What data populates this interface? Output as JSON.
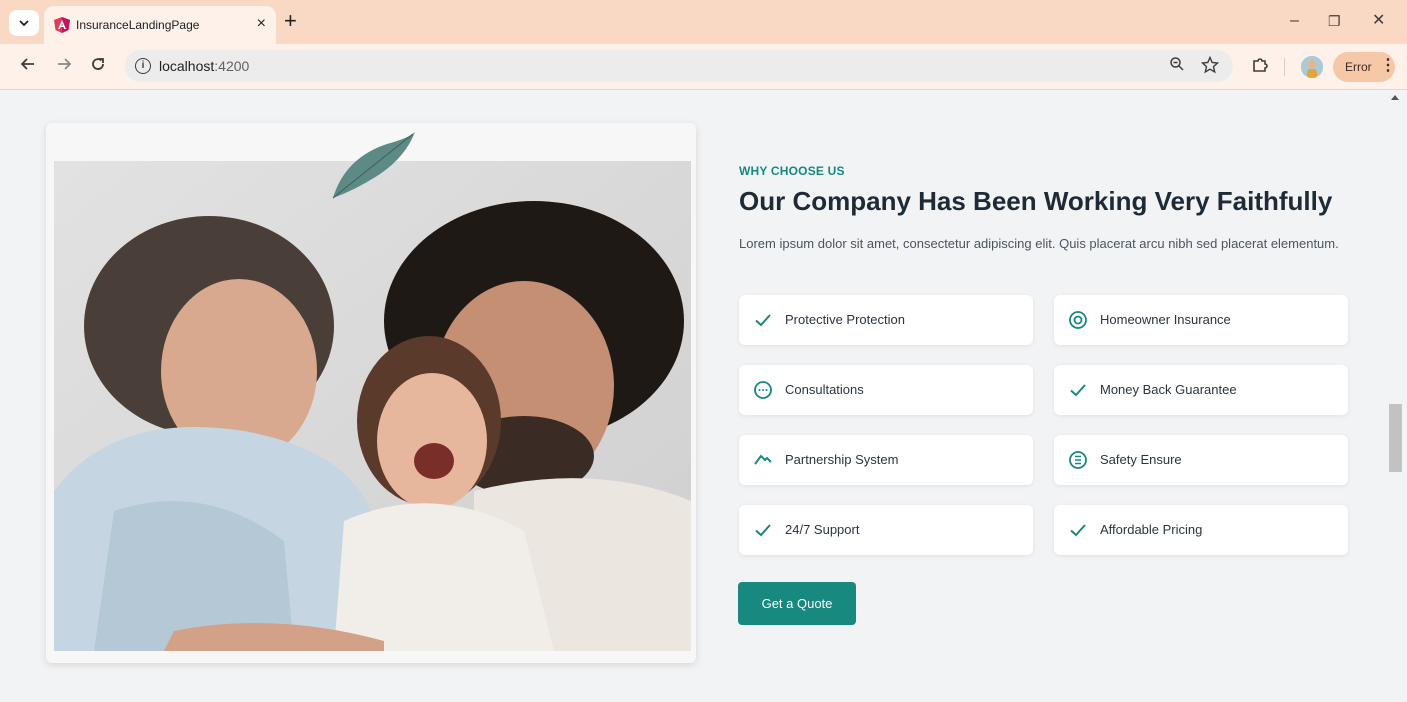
{
  "browser": {
    "tab_title": "InsuranceLandingPage",
    "tab_close": "×",
    "new_tab": "+",
    "window_controls": {
      "minimize": "–",
      "restore": "❐",
      "close": "✕"
    },
    "url_host": "localhost",
    "url_port": ":4200",
    "error_label": "Error",
    "icons": [
      "tab-dropdown-icon",
      "angular-favicon",
      "back-arrow-icon",
      "forward-arrow-icon",
      "reload-icon",
      "site-info-icon",
      "zoom-icon",
      "bookmark-star-icon",
      "extensions-icon",
      "profile-avatar",
      "menu-dots-icon"
    ]
  },
  "section": {
    "eyebrow": "WHY CHOOSE US",
    "heading": "Our Company Has Been Working Very Faithfully",
    "description": "Lorem ipsum dolor sit amet, consectetur adipiscing elit. Quis placerat arcu nibh sed placerat elementum.",
    "features": [
      {
        "label": "Protective Protection",
        "icon": "check-icon"
      },
      {
        "label": "Homeowner Insurance",
        "icon": "target-circle-icon"
      },
      {
        "label": "Consultations",
        "icon": "chat-dots-icon"
      },
      {
        "label": "Money Back Guarantee",
        "icon": "check-icon"
      },
      {
        "label": "Partnership System",
        "icon": "handshake-icon"
      },
      {
        "label": "Safety Ensure",
        "icon": "list-circle-icon"
      },
      {
        "label": "24/7 Support",
        "icon": "check-icon"
      },
      {
        "label": "Affordable Pricing",
        "icon": "check-icon"
      }
    ],
    "cta_label": "Get a Quote"
  },
  "colors": {
    "accent": "#17897f",
    "heading": "#1e2a35",
    "tabbar": "#f9d9c3",
    "page_bg": "#f2f3f5"
  }
}
